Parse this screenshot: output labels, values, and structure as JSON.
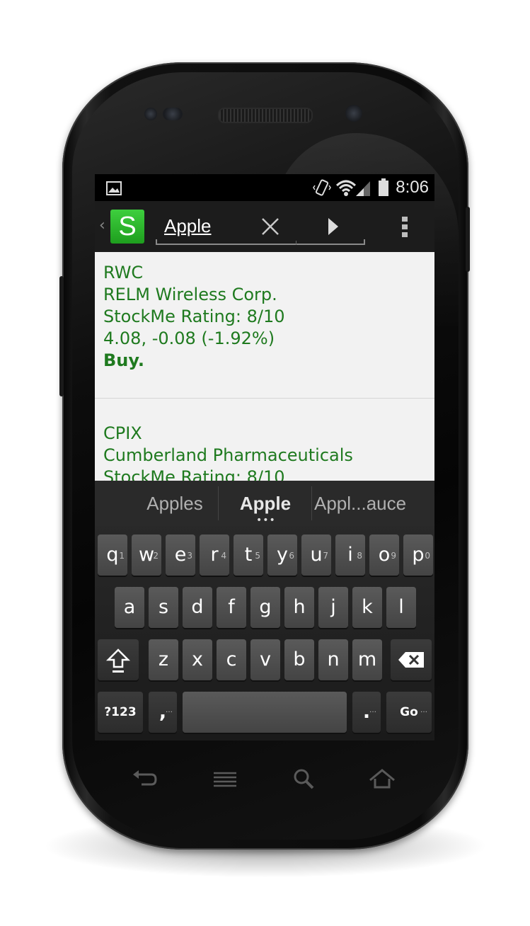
{
  "statusbar": {
    "time": "8:06"
  },
  "actionbar": {
    "app_icon_letter": "S",
    "search_value": "Apple"
  },
  "results": [
    {
      "symbol": "RWC",
      "name": "RELM Wireless Corp.",
      "rating": "StockMe Rating: 8/10",
      "price": "4.08, -0.08 (-1.92%)",
      "recommendation": "Buy."
    },
    {
      "symbol": "CPIX",
      "name": "Cumberland Pharmaceuticals",
      "rating": "StockMe Rating: 8/10"
    }
  ],
  "keyboard": {
    "suggestions": [
      "Apples",
      "Apple",
      "Appl...auce"
    ],
    "row1": [
      {
        "k": "q",
        "n": "1"
      },
      {
        "k": "w",
        "n": "2"
      },
      {
        "k": "e",
        "n": "3"
      },
      {
        "k": "r",
        "n": "4"
      },
      {
        "k": "t",
        "n": "5"
      },
      {
        "k": "y",
        "n": "6"
      },
      {
        "k": "u",
        "n": "7"
      },
      {
        "k": "i",
        "n": "8"
      },
      {
        "k": "o",
        "n": "9"
      },
      {
        "k": "p",
        "n": "0"
      }
    ],
    "row2": [
      "a",
      "s",
      "d",
      "f",
      "g",
      "h",
      "j",
      "k",
      "l"
    ],
    "row3": [
      "z",
      "x",
      "c",
      "v",
      "b",
      "n",
      "m"
    ],
    "symbols_label": "?123",
    "comma_label": ",",
    "period_label": ".",
    "go_label": "Go"
  },
  "colors": {
    "accent_green": "#1f9e1f",
    "result_text": "#1f7a1f",
    "result_bg": "#f2f2f2"
  },
  "icons": {
    "status": [
      "picture-icon",
      "vibrate-icon",
      "wifi-icon",
      "signal-icon",
      "battery-icon"
    ],
    "nav": [
      "back-icon",
      "menu-icon",
      "search-icon",
      "home-icon"
    ]
  }
}
